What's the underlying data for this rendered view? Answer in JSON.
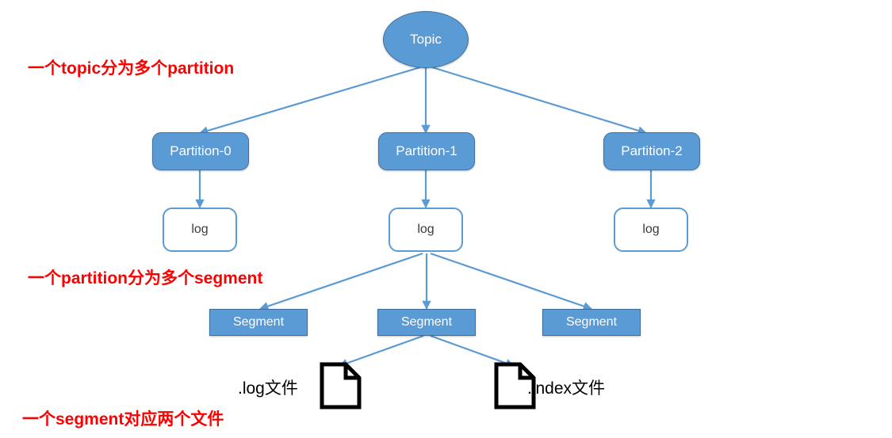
{
  "diagram": {
    "title_node": {
      "label": "Topic",
      "shape": "ellipse"
    },
    "partitions": [
      {
        "label": "Partition-0"
      },
      {
        "label": "Partition-1"
      },
      {
        "label": "Partition-2"
      }
    ],
    "logs": [
      {
        "label": "log"
      },
      {
        "label": "log"
      },
      {
        "label": "log"
      }
    ],
    "segments": [
      {
        "label": "Segment"
      },
      {
        "label": "Segment"
      },
      {
        "label": "Segment"
      }
    ],
    "files": [
      {
        "label": ".log文件",
        "icon": "document-icon"
      },
      {
        "label": ".index文件",
        "icon": "document-icon"
      }
    ],
    "annotations": [
      {
        "text": "一个topic分为多个partition"
      },
      {
        "text": "一个partition分为多个segment"
      },
      {
        "text": "一个segment对应两个文件"
      }
    ],
    "colors": {
      "node_fill": "#5B9BD5",
      "node_stroke": "#41719C",
      "edge": "#5B9BD5",
      "annotation": "#FF0000",
      "file_outline": "#000000",
      "background": "#FFFFFF"
    }
  }
}
